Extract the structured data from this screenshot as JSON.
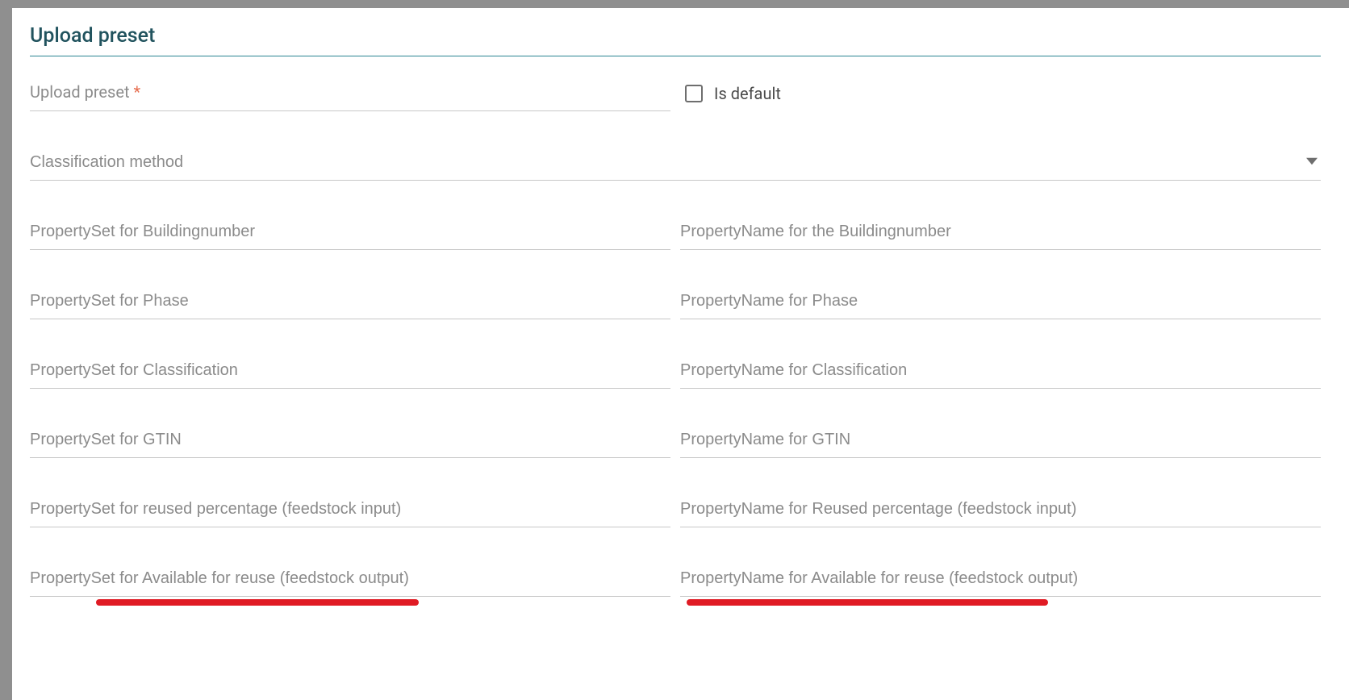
{
  "dialog": {
    "title": "Upload preset"
  },
  "fields": {
    "upload_preset": {
      "label": "Upload preset",
      "required": "*"
    },
    "is_default": {
      "label": "Is default"
    },
    "classification_method": {
      "label": "Classification method"
    },
    "rows": [
      {
        "left": "PropertySet for Buildingnumber",
        "right": "PropertyName for the Buildingnumber"
      },
      {
        "left": "PropertySet for Phase",
        "right": "PropertyName for Phase"
      },
      {
        "left": "PropertySet for Classification",
        "right": "PropertyName for Classification"
      },
      {
        "left": "PropertySet for GTIN",
        "right": "PropertyName for GTIN"
      },
      {
        "left": "PropertySet for reused percentage (feedstock input)",
        "right": "PropertyName for Reused percentage (feedstock input)"
      },
      {
        "left": "PropertySet for Available for reuse (feedstock output)",
        "right": "PropertyName for Available for reuse (feedstock output)"
      }
    ]
  }
}
